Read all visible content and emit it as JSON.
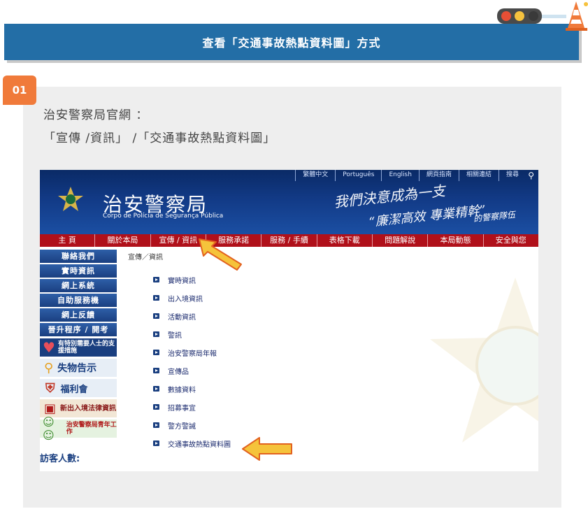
{
  "banner": {
    "title": "查看「交通事故熱點資料圖」方式"
  },
  "colors": {
    "banner": "#236ea6",
    "step_badge": "#f07a3a",
    "card": "#eeeeee",
    "nav": "#b0101a",
    "arrow": "#f5c33b"
  },
  "step": {
    "number": "01",
    "line1": "治安警察局官網 ：",
    "line2": "「宣傳 /資訊」 /「交通事故熱點資料圖」"
  },
  "site": {
    "toplinks": [
      "繁體中文",
      "Português",
      "English",
      "網頁指南",
      "相關連結",
      "搜尋"
    ],
    "title": "治安警察局",
    "subtitle": "Corpo de Polícia de Segurança Pública",
    "slogan1": "我們決意成為一支",
    "slogan2": "“廉潔高效 專業精幹”",
    "slogan3": "的警察隊伍",
    "nav": [
      "主 頁",
      "關於本局",
      "宣傳 / 資訊",
      "服務承諾",
      "服務 / 手續",
      "表格下載",
      "問題解說",
      "本局動態",
      "安全與您"
    ],
    "sidebar_buttons": [
      "聯絡我們",
      "實時資訊",
      "網上系統",
      "自助服務機",
      "網上反饋",
      "晉升程序 / 開考"
    ],
    "sidebar_images": [
      {
        "label": "有特別需要人士的支援措施",
        "icon": "heart-icon"
      },
      {
        "label": "失物告示",
        "icon": "magnifier-icon"
      },
      {
        "label": "福利會",
        "icon": "shield-icon"
      },
      {
        "label": "新出入境法律資訊",
        "icon": "book-icon"
      },
      {
        "label": "治安警察局青年工作",
        "icon": "people-icon"
      }
    ],
    "visitor_label": "訪客人數:",
    "breadcrumb": "宣傳／資訊",
    "links": [
      "實時資訊",
      "出入境資訊",
      "活動資訊",
      "警訊",
      "治安警察局年報",
      "宣傳品",
      "數據資料",
      "招募事宜",
      "警方警誡",
      "交通事故熱點資料圖"
    ]
  }
}
